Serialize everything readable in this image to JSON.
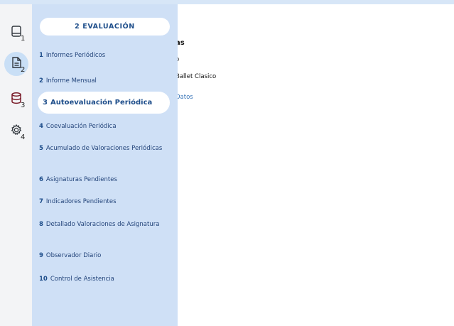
{
  "left_rail": {
    "items": [
      {
        "icon": "book-icon",
        "sub": "1"
      },
      {
        "icon": "document-icon",
        "sub": "2"
      },
      {
        "icon": "database-icon",
        "sub": "3"
      },
      {
        "icon": "gear-icon",
        "sub": "4"
      }
    ]
  },
  "menu": {
    "header": "2  EVALUACIÓN",
    "items": [
      {
        "num": "1",
        "label": "Informes Periódicos"
      },
      {
        "num": "2",
        "label": "Informe Mensual"
      },
      {
        "num": "3",
        "label": "Autoevaluación Periódica"
      },
      {
        "num": "4",
        "label": "Coevaluación Periódica"
      },
      {
        "num": "5",
        "label": "Acumulado de Valoraciones Periódicas"
      },
      {
        "num": "6",
        "label": "Asignaturas Pendientes"
      },
      {
        "num": "7",
        "label": "Indicadores Pendientes"
      },
      {
        "num": "8",
        "label": "Detallado Valoraciones de Asignatura"
      },
      {
        "num": "9",
        "label": "Observador Diario"
      },
      {
        "num": "10",
        "label": "Control de Asistencia"
      }
    ]
  },
  "background": {
    "line1": "as",
    "line2": "o",
    "line3": "Ballet Clasico",
    "line4": "Datos"
  }
}
